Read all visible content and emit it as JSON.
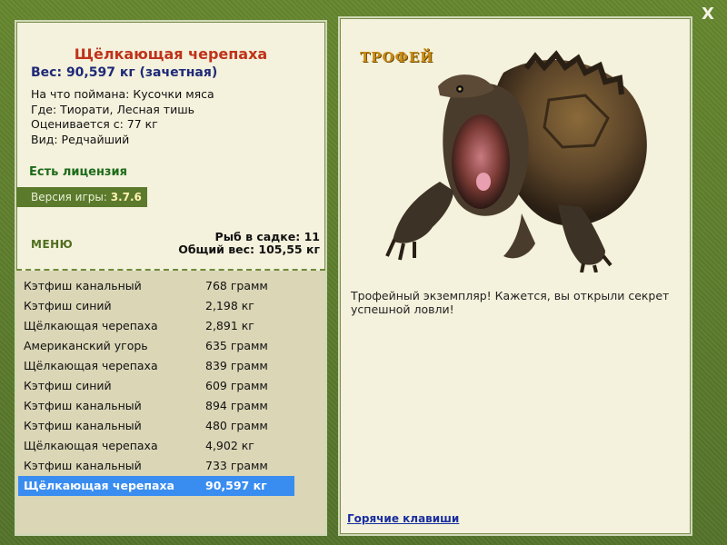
{
  "window": {
    "close_label": "X"
  },
  "fish": {
    "title": "Щёлкающая черепаха",
    "weight": "Вес: 90,597 кг (зачетная)",
    "bait": "На что поймана: Кусочки мяса",
    "place": "Где: Тиорати, Лесная тишь",
    "valued_from": "Оценивается с: 77 кг",
    "rarity": "Вид: Редчайший"
  },
  "license": "Есть лицензия",
  "version": {
    "label": "Версия игры:",
    "value": "3.7.6"
  },
  "menu_label": "МЕНЮ",
  "stats": {
    "fish_count": "Рыб в садке: 11",
    "total_weight": "Общий вес: 105,55 кг"
  },
  "catch_list": [
    {
      "name": "Кэтфиш канальный",
      "weight": "768 грамм"
    },
    {
      "name": "Кэтфиш синий",
      "weight": "2,198 кг"
    },
    {
      "name": "Щёлкающая черепаха",
      "weight": "2,891 кг"
    },
    {
      "name": "Американский угорь",
      "weight": "635 грамм"
    },
    {
      "name": "Щёлкающая черепаха",
      "weight": "839 грамм"
    },
    {
      "name": "Кэтфиш синий",
      "weight": "609 грамм"
    },
    {
      "name": "Кэтфиш канальный",
      "weight": "894 грамм"
    },
    {
      "name": "Кэтфиш канальный",
      "weight": "480 грамм"
    },
    {
      "name": "Щёлкающая черепаха",
      "weight": "4,902 кг"
    },
    {
      "name": "Кэтфиш канальный",
      "weight": "733 грамм"
    },
    {
      "name": "Щёлкающая черепаха",
      "weight": "90,597 кг"
    }
  ],
  "selected_index": 10,
  "trophy": {
    "label": "ТРОФЕЙ",
    "text": "Трофейный экземпляр! Кажется, вы открыли секрет успешной ловли!"
  },
  "hotkeys_label": "Горячие клавиши",
  "colors": {
    "frame": "#5b7a2c",
    "panel": "#f4f1dc",
    "list_bg": "#dad6b6",
    "selection": "#3a8df0",
    "title_red": "#c0321a",
    "weight_blue": "#1e2a78",
    "license_green": "#1d6b1a",
    "trophy_gold": "#c98b14"
  },
  "icons": {
    "close": "close-icon",
    "trophy_image": "snapping-turtle-image"
  }
}
